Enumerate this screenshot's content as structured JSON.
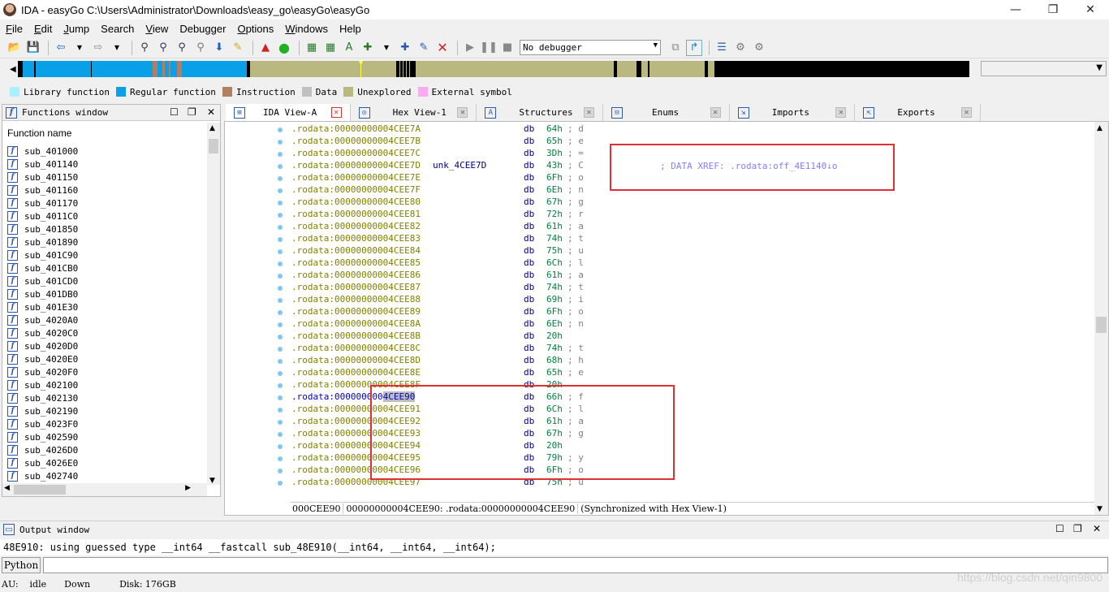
{
  "window": {
    "title": "IDA - easyGo C:\\Users\\Administrator\\Downloads\\easy_go\\easyGo\\easyGo",
    "controls": [
      "—",
      "❐",
      "✕"
    ]
  },
  "menu": [
    {
      "key": "F",
      "rest": "ile"
    },
    {
      "key": "E",
      "rest": "dit"
    },
    {
      "key": "J",
      "rest": "ump"
    },
    {
      "key": "",
      "rest": "Search",
      "ulIndex": 6
    },
    {
      "key": "V",
      "rest": "iew"
    },
    {
      "key": "",
      "rest": "Debugger"
    },
    {
      "key": "O",
      "rest": "ptions"
    },
    {
      "key": "W",
      "rest": "indows"
    },
    {
      "key": "",
      "rest": "Help"
    }
  ],
  "toolbar": {
    "debugger": "No debugger"
  },
  "legend": [
    {
      "label": "Library function",
      "color": "#aaf0ff"
    },
    {
      "label": "Regular function",
      "color": "#0aa0e8"
    },
    {
      "label": "Instruction",
      "color": "#b08060"
    },
    {
      "label": "Data",
      "color": "#c0c0c0"
    },
    {
      "label": "Unexplored",
      "color": "#b8b880"
    },
    {
      "label": "External symbol",
      "color": "#ffaaf0"
    }
  ],
  "functions_window": {
    "title": "Functions window",
    "column": "Function name",
    "items": [
      "sub_401000",
      "sub_401140",
      "sub_401150",
      "sub_401160",
      "sub_401170",
      "sub_4011C0",
      "sub_401850",
      "sub_401890",
      "sub_401C90",
      "sub_401CB0",
      "sub_401CD0",
      "sub_401DB0",
      "sub_401E30",
      "sub_4020A0",
      "sub_4020C0",
      "sub_4020D0",
      "sub_4020E0",
      "sub_4020F0",
      "sub_402100",
      "sub_402130",
      "sub_402190",
      "sub_4023F0",
      "sub_402590",
      "sub_4026D0",
      "sub_4026E0",
      "sub_402740"
    ]
  },
  "tabs": [
    {
      "label": "IDA View-A",
      "icon": "graph-view-icon",
      "active": true
    },
    {
      "label": "Hex View-1",
      "icon": "hex-view-icon",
      "active": false
    },
    {
      "label": "Structures",
      "icon": "structures-icon",
      "active": false
    },
    {
      "label": "Enums",
      "icon": "enums-icon",
      "active": false
    },
    {
      "label": "Imports",
      "icon": "imports-icon",
      "active": false
    },
    {
      "label": "Exports",
      "icon": "exports-icon",
      "active": false
    }
  ],
  "disasm": [
    {
      "addr": ".rodata:00000000004CEE7A",
      "label": "",
      "op": "db",
      "val": "64h",
      "cmt": "; d"
    },
    {
      "addr": ".rodata:00000000004CEE7B",
      "label": "",
      "op": "db",
      "val": "65h",
      "cmt": "; e"
    },
    {
      "addr": ".rodata:00000000004CEE7C",
      "label": "",
      "op": "db",
      "val": "3Dh",
      "cmt": "; ="
    },
    {
      "addr": ".rodata:00000000004CEE7D",
      "label": "unk_4CEE7D",
      "op": "db",
      "val": "43h",
      "cmt": "; C"
    },
    {
      "addr": ".rodata:00000000004CEE7E",
      "label": "",
      "op": "db",
      "val": "6Fh",
      "cmt": "; o"
    },
    {
      "addr": ".rodata:00000000004CEE7F",
      "label": "",
      "op": "db",
      "val": "6Eh",
      "cmt": "; n"
    },
    {
      "addr": ".rodata:00000000004CEE80",
      "label": "",
      "op": "db",
      "val": "67h",
      "cmt": "; g"
    },
    {
      "addr": ".rodata:00000000004CEE81",
      "label": "",
      "op": "db",
      "val": "72h",
      "cmt": "; r"
    },
    {
      "addr": ".rodata:00000000004CEE82",
      "label": "",
      "op": "db",
      "val": "61h",
      "cmt": "; a"
    },
    {
      "addr": ".rodata:00000000004CEE83",
      "label": "",
      "op": "db",
      "val": "74h",
      "cmt": "; t"
    },
    {
      "addr": ".rodata:00000000004CEE84",
      "label": "",
      "op": "db",
      "val": "75h",
      "cmt": "; u"
    },
    {
      "addr": ".rodata:00000000004CEE85",
      "label": "",
      "op": "db",
      "val": "6Ch",
      "cmt": "; l"
    },
    {
      "addr": ".rodata:00000000004CEE86",
      "label": "",
      "op": "db",
      "val": "61h",
      "cmt": "; a"
    },
    {
      "addr": ".rodata:00000000004CEE87",
      "label": "",
      "op": "db",
      "val": "74h",
      "cmt": "; t"
    },
    {
      "addr": ".rodata:00000000004CEE88",
      "label": "",
      "op": "db",
      "val": "69h",
      "cmt": "; i"
    },
    {
      "addr": ".rodata:00000000004CEE89",
      "label": "",
      "op": "db",
      "val": "6Fh",
      "cmt": "; o"
    },
    {
      "addr": ".rodata:00000000004CEE8A",
      "label": "",
      "op": "db",
      "val": "6Eh",
      "cmt": "; n"
    },
    {
      "addr": ".rodata:00000000004CEE8B",
      "label": "",
      "op": "db",
      "val": "20h",
      "cmt": ""
    },
    {
      "addr": ".rodata:00000000004CEE8C",
      "label": "",
      "op": "db",
      "val": "74h",
      "cmt": "; t"
    },
    {
      "addr": ".rodata:00000000004CEE8D",
      "label": "",
      "op": "db",
      "val": "68h",
      "cmt": "; h"
    },
    {
      "addr": ".rodata:00000000004CEE8E",
      "label": "",
      "op": "db",
      "val": "65h",
      "cmt": "; e"
    },
    {
      "addr": ".rodata:00000000004CEE8F",
      "label": "",
      "op": "db",
      "val": "20h",
      "cmt": ""
    },
    {
      "addr": ".rodata:000000000",
      "addr_hl": "4CEE90",
      "current": true,
      "label": "",
      "op": "db",
      "val": "66h",
      "cmt": "; f"
    },
    {
      "addr": ".rodata:00000000004CEE91",
      "label": "",
      "op": "db",
      "val": "6Ch",
      "cmt": "; l"
    },
    {
      "addr": ".rodata:00000000004CEE92",
      "label": "",
      "op": "db",
      "val": "61h",
      "cmt": "; a"
    },
    {
      "addr": ".rodata:00000000004CEE93",
      "label": "",
      "op": "db",
      "val": "67h",
      "cmt": "; g"
    },
    {
      "addr": ".rodata:00000000004CEE94",
      "label": "",
      "op": "db",
      "val": "20h",
      "cmt": ""
    },
    {
      "addr": ".rodata:00000000004CEE95",
      "label": "",
      "op": "db",
      "val": "79h",
      "cmt": "; y"
    },
    {
      "addr": ".rodata:00000000004CEE96",
      "label": "",
      "op": "db",
      "val": "6Fh",
      "cmt": "; o"
    },
    {
      "addr": ".rodata:00000000004CEE97",
      "label": "",
      "op": "db",
      "val": "75h",
      "cmt": "; u"
    }
  ],
  "xref": "; DATA XREF: .rodata:off_4E1140↓o",
  "ida_status": [
    "000CEE90",
    "00000000004CEE90: .rodata:00000000004CEE90",
    "(Synchronized with Hex View-1)"
  ],
  "output": {
    "title": "Output window",
    "line": "48E910: using guessed type __int64 __fastcall sub_48E910(__int64, __int64, __int64);",
    "python_label": "Python"
  },
  "status": {
    "au": "AU:",
    "state": "idle",
    "dir": "Down",
    "disk": "Disk: 176GB"
  },
  "watermark": "https://blog.csdn.net/qin9800"
}
